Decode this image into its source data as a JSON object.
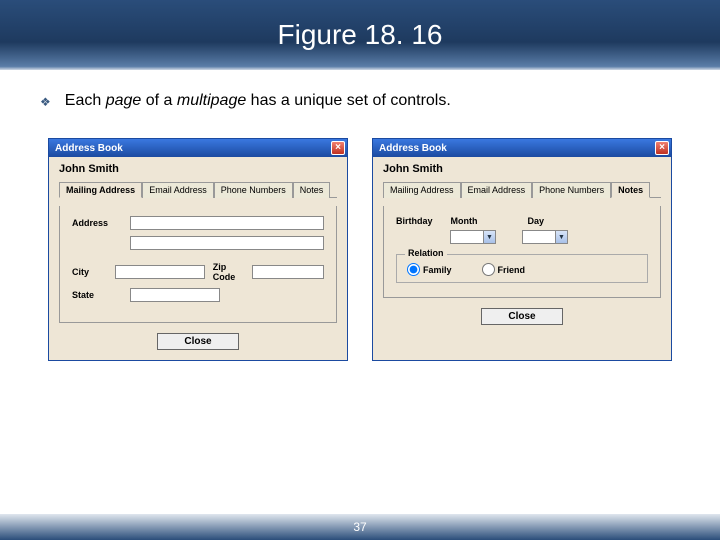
{
  "header": {
    "title": "Figure 18. 16"
  },
  "bullet": {
    "prefix": "Each ",
    "i1": "page",
    "mid": " of a ",
    "i2": "multipage",
    "suffix": " has a unique set of controls."
  },
  "footer": {
    "page": "37"
  },
  "tabs": {
    "mailing": "Mailing Address",
    "email": "Email Address",
    "phone": "Phone Numbers",
    "notes": "Notes"
  },
  "common": {
    "title": "Address Book",
    "name": "John Smith",
    "close": "Close",
    "x": "×"
  },
  "left": {
    "address": "Address",
    "city": "City",
    "state": "State",
    "zip": "Zip Code"
  },
  "right": {
    "birthday": "Birthday",
    "month": "Month",
    "day": "Day",
    "legend": "Relation",
    "family": "Family",
    "friend": "Friend"
  }
}
